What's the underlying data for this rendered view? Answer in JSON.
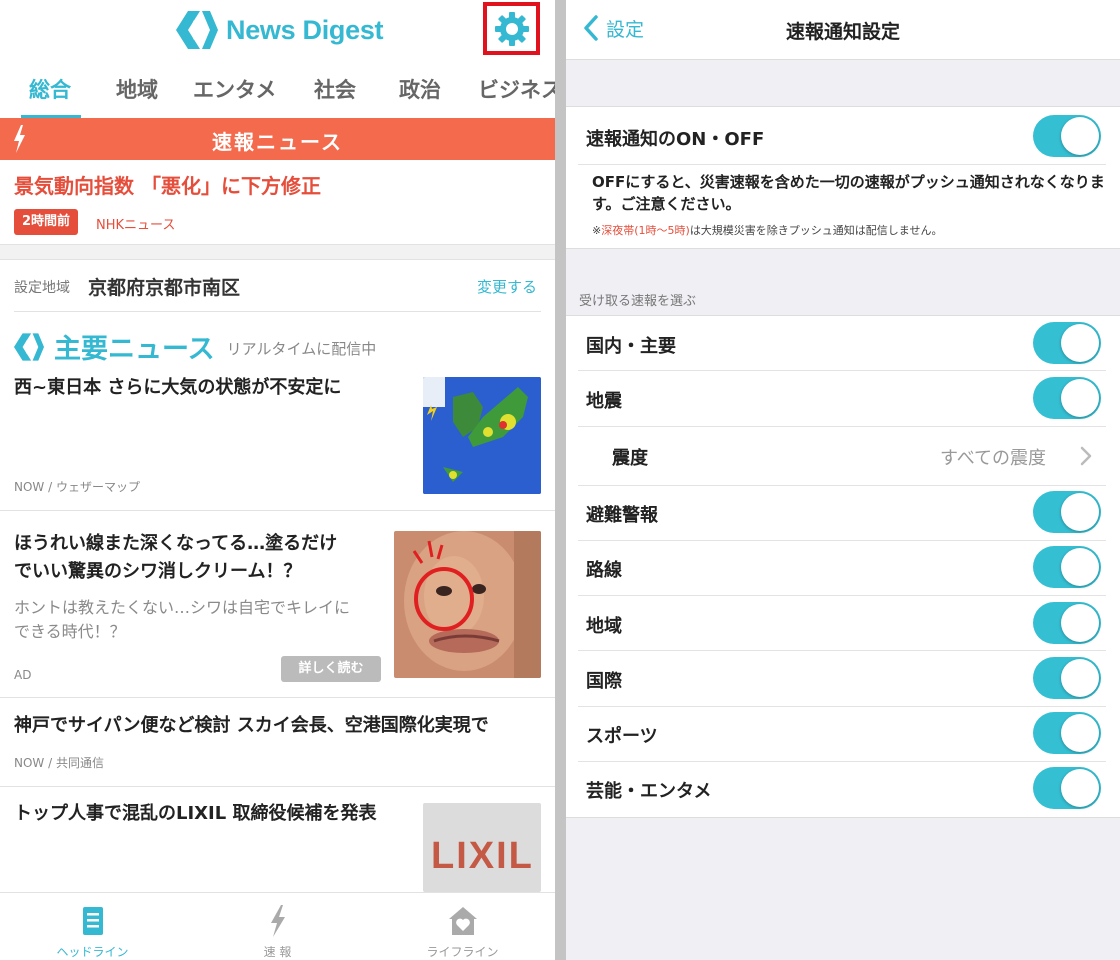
{
  "left": {
    "app_name": "News Digest",
    "tabs": [
      "総合",
      "地域",
      "エンタメ",
      "社会",
      "政治",
      "ビジネス"
    ],
    "breaking": {
      "bar_label": "速報ニュース",
      "title": "景気動向指数 「悪化」に下方修正",
      "time_badge": "2時間前",
      "source": "NHKニュース"
    },
    "region": {
      "label": "設定地域",
      "value": "京都府京都市南区",
      "change": "変更する"
    },
    "main_news": {
      "title": "主要ニュース",
      "subtitle": "リアルタイムに配信中"
    },
    "articles": [
      {
        "title": "西~東日本 さらに大気の状態が不安定に",
        "meta": "NOW / ウェザーマップ"
      },
      {
        "title_line1": "ほうれい線また深くなってる…塗るだけ",
        "title_line2": "でいい驚異のシワ消しクリーム！？",
        "desc_line1": "ホントは教えたくない…シワは自宅でキレイに",
        "desc_line2": "できる時代！？",
        "meta": "AD",
        "button": "詳しく読む"
      },
      {
        "title": "神戸でサイパン便など検討 スカイ会長、空港国際化実現で",
        "meta": "NOW / 共同通信"
      },
      {
        "title": "トップ人事で混乱のLIXIL 取締役候補を発表",
        "thumb_text": "LIXIL"
      }
    ],
    "bottom_nav": [
      "ヘッドライン",
      "速 報",
      "ライフライン"
    ]
  },
  "right": {
    "back_label": "設定",
    "title": "速報通知設定",
    "master": {
      "label": "速報通知のON・OFF",
      "on": true,
      "note": "OFFにすると、災害速報を含めた一切の速報がプッシュ通知されなくなります。ご注意ください。",
      "small_prefix": "※",
      "small_red": "深夜帯(1時〜5時)",
      "small_rest": "は大規模災害を除きプッシュ通知は配信しません。"
    },
    "section_label": "受け取る速報を選ぶ",
    "items": [
      {
        "label": "国内・主要",
        "on": true
      },
      {
        "label": "地震",
        "on": true
      },
      {
        "label": "震度",
        "value": "すべての震度"
      },
      {
        "label": "避難警報",
        "on": true
      },
      {
        "label": "路線",
        "on": true
      },
      {
        "label": "地域",
        "on": true
      },
      {
        "label": "国際",
        "on": true
      },
      {
        "label": "スポーツ",
        "on": true
      },
      {
        "label": "芸能・エンタメ",
        "on": true
      }
    ]
  },
  "colors": {
    "accent": "#35b8d1",
    "breaking": "#f46a4d",
    "highlight_box": "#e0121e",
    "toggle_on": "#35bfd3"
  }
}
